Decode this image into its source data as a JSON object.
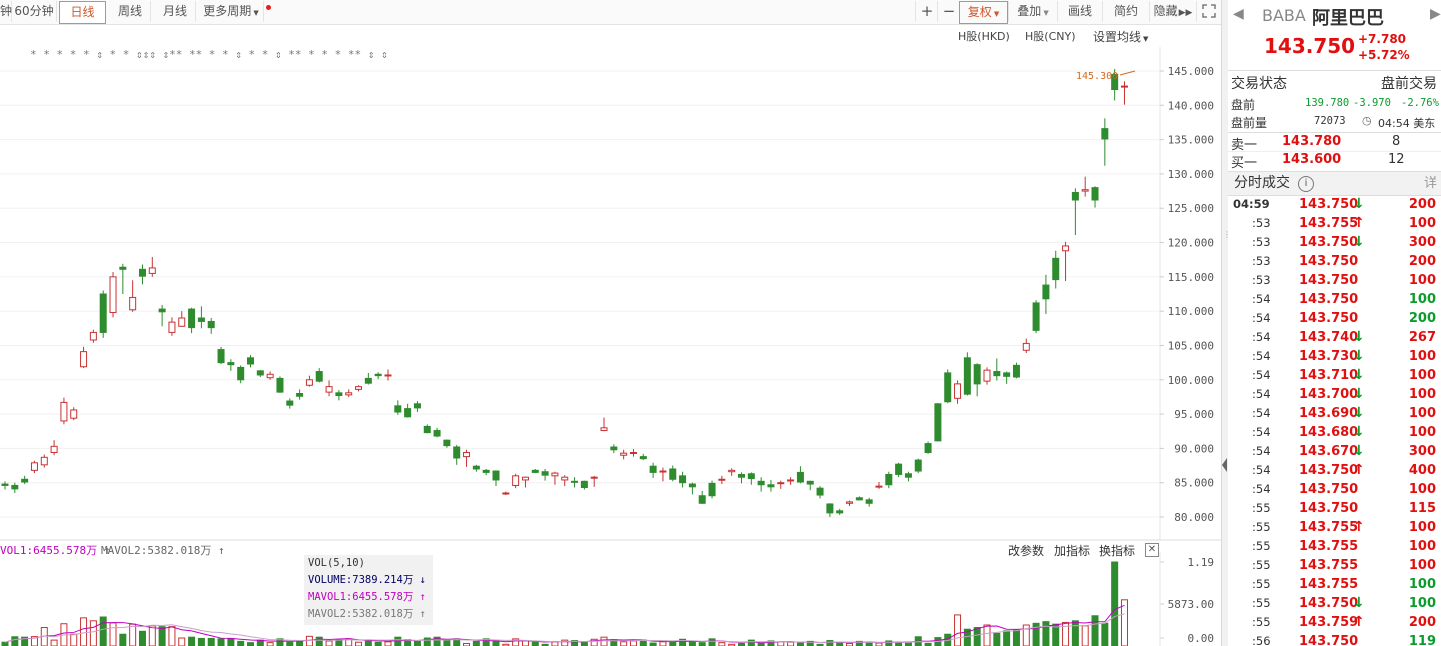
{
  "toolbar": {
    "periods": [
      {
        "label": "钟",
        "active": false
      },
      {
        "label": "60分钟",
        "active": false
      },
      {
        "label": "日线",
        "active": true
      },
      {
        "label": "周线",
        "active": false
      },
      {
        "label": "月线",
        "active": false
      },
      {
        "label": "更多周期",
        "active": false
      }
    ],
    "plus": "+",
    "minus": "−",
    "fuquan": "复权",
    "diejia": "叠加",
    "huaxian": "画线",
    "jianyue": "简约",
    "yincang": "隐藏",
    "expand_icon": "expand-icon"
  },
  "overlay": {
    "hk_hkd": "H股(HKD)",
    "hk_cny": "H股(CNY)",
    "ma_setting": "设置均线",
    "max_label": "145.300",
    "markers": "* * * * * ⇕ * * ⇕⇕⇕ ⇕** ** * * ⇕ * * ⇕ ** * * * ** ⇕ ⇕"
  },
  "price_axis": [
    "145.000",
    "140.000",
    "135.000",
    "130.000",
    "125.000",
    "120.000",
    "115.000",
    "110.000",
    "105.000",
    "100.000",
    "95.000",
    "90.000",
    "85.000",
    "80.000"
  ],
  "vol_axis": [
    "1.19",
    "5873.00",
    "0.00"
  ],
  "vol_header": {
    "mavol1": "VOL1:6455.578万",
    "mavol2": "MAVOL2:5382.018万",
    "gaicanshu": "改参数",
    "jiazhibiao": "加指标",
    "huanzhibiao": "换指标"
  },
  "tooltip": {
    "title": "VOL(5,10)",
    "volume": "VOLUME:7389.214万",
    "mavol1": "MAVOL1:6455.578万",
    "mavol2": "MAVOL2:5382.018万"
  },
  "quote": {
    "symbol": "BABA",
    "name": "阿里巴巴",
    "price": "143.750",
    "change": "+7.780",
    "change_pct": "+5.72%",
    "status_label": "交易状态",
    "status_value": "盘前交易",
    "pre_label": "盘前",
    "pre_price": "139.780",
    "pre_change": "-3.970",
    "pre_pct": "-2.76%",
    "pre_vol_label": "盘前量",
    "pre_vol": "72073",
    "time": "04:54 美东",
    "sell_label": "卖一",
    "sell_price": "143.780",
    "sell_qty": "8",
    "buy_label": "买一",
    "buy_price": "143.600",
    "buy_qty": "12"
  },
  "ticks_section": {
    "title": "分时成交",
    "detail": "详"
  },
  "ticks": [
    {
      "time": "04:59",
      "price": "143.750",
      "dir": "down",
      "vol": "200",
      "vc": "red"
    },
    {
      "time": ":53",
      "price": "143.755",
      "dir": "up",
      "vol": "100",
      "vc": "red"
    },
    {
      "time": ":53",
      "price": "143.750",
      "dir": "down",
      "vol": "300",
      "vc": "red"
    },
    {
      "time": ":53",
      "price": "143.750",
      "dir": "",
      "vol": "200",
      "vc": "red"
    },
    {
      "time": ":53",
      "price": "143.750",
      "dir": "",
      "vol": "100",
      "vc": "red"
    },
    {
      "time": ":54",
      "price": "143.750",
      "dir": "",
      "vol": "100",
      "vc": "green"
    },
    {
      "time": ":54",
      "price": "143.750",
      "dir": "",
      "vol": "200",
      "vc": "green"
    },
    {
      "time": ":54",
      "price": "143.740",
      "dir": "down",
      "vol": "267",
      "vc": "red"
    },
    {
      "time": ":54",
      "price": "143.730",
      "dir": "down",
      "vol": "100",
      "vc": "red"
    },
    {
      "time": ":54",
      "price": "143.710",
      "dir": "down",
      "vol": "100",
      "vc": "red"
    },
    {
      "time": ":54",
      "price": "143.700",
      "dir": "down",
      "vol": "100",
      "vc": "red"
    },
    {
      "time": ":54",
      "price": "143.690",
      "dir": "down",
      "vol": "100",
      "vc": "red"
    },
    {
      "time": ":54",
      "price": "143.680",
      "dir": "down",
      "vol": "100",
      "vc": "red"
    },
    {
      "time": ":54",
      "price": "143.670",
      "dir": "down",
      "vol": "300",
      "vc": "red"
    },
    {
      "time": ":54",
      "price": "143.750",
      "dir": "up",
      "vol": "400",
      "vc": "red"
    },
    {
      "time": ":54",
      "price": "143.750",
      "dir": "",
      "vol": "100",
      "vc": "red"
    },
    {
      "time": ":55",
      "price": "143.750",
      "dir": "",
      "vol": "115",
      "vc": "red"
    },
    {
      "time": ":55",
      "price": "143.755",
      "dir": "up",
      "vol": "100",
      "vc": "red"
    },
    {
      "time": ":55",
      "price": "143.755",
      "dir": "",
      "vol": "100",
      "vc": "red"
    },
    {
      "time": ":55",
      "price": "143.755",
      "dir": "",
      "vol": "100",
      "vc": "red"
    },
    {
      "time": ":55",
      "price": "143.755",
      "dir": "",
      "vol": "100",
      "vc": "green"
    },
    {
      "time": ":55",
      "price": "143.750",
      "dir": "down",
      "vol": "100",
      "vc": "green"
    },
    {
      "time": ":55",
      "price": "143.759",
      "dir": "up",
      "vol": "200",
      "vc": "red"
    },
    {
      "time": ":56",
      "price": "143.750",
      "dir": "",
      "vol": "119",
      "vc": "green"
    }
  ],
  "chart_data": {
    "type": "candlestick",
    "price_range": [
      78,
      146
    ],
    "candles": [
      [
        84.8,
        84.6,
        85.2,
        84.0
      ],
      [
        84.6,
        84.1,
        85.0,
        83.5
      ],
      [
        85.5,
        85.1,
        86.0,
        84.8
      ],
      [
        86.8,
        87.9,
        88.2,
        86.4
      ],
      [
        87.6,
        88.7,
        89.1,
        87.2
      ],
      [
        89.4,
        90.3,
        91.2,
        89.0
      ],
      [
        94.0,
        96.7,
        97.4,
        93.5
      ],
      [
        94.4,
        95.6,
        96.0,
        94.1
      ],
      [
        101.9,
        104.1,
        104.8,
        101.7
      ],
      [
        105.8,
        106.9,
        107.3,
        105.4
      ],
      [
        112.5,
        106.9,
        113.0,
        106.1
      ],
      [
        109.8,
        115.0,
        115.7,
        109.1
      ],
      [
        116.4,
        116.1,
        116.9,
        112.5
      ],
      [
        110.2,
        112.0,
        114.5,
        109.9
      ],
      [
        116.1,
        115.1,
        116.8,
        113.9
      ],
      [
        115.5,
        116.3,
        117.9,
        115.0
      ],
      [
        110.3,
        109.9,
        110.9,
        107.8
      ],
      [
        106.9,
        108.4,
        109.1,
        106.4
      ],
      [
        107.8,
        109.0,
        110.0,
        107.7
      ],
      [
        110.3,
        107.6,
        110.5,
        106.8
      ],
      [
        109.0,
        108.5,
        110.7,
        107.5
      ],
      [
        108.5,
        107.6,
        109.0,
        106.7
      ],
      [
        104.4,
        102.5,
        104.8,
        102.3
      ],
      [
        102.5,
        102.2,
        103.0,
        101.3
      ],
      [
        101.8,
        100.0,
        102.1,
        99.5
      ],
      [
        103.2,
        102.3,
        103.6,
        101.8
      ],
      [
        101.3,
        100.7,
        101.4,
        100.4
      ],
      [
        100.3,
        100.8,
        101.2,
        100.0
      ],
      [
        100.2,
        98.2,
        100.5,
        98.1
      ],
      [
        96.9,
        96.3,
        97.3,
        95.8
      ],
      [
        98.0,
        97.6,
        98.6,
        97.1
      ],
      [
        99.2,
        100.0,
        100.6,
        99.0
      ],
      [
        101.2,
        99.8,
        101.7,
        99.6
      ],
      [
        98.2,
        99.0,
        99.9,
        97.6
      ],
      [
        98.1,
        97.7,
        98.5,
        97.0
      ],
      [
        97.8,
        98.1,
        98.6,
        97.5
      ],
      [
        98.6,
        99.0,
        99.2,
        98.3
      ],
      [
        100.2,
        99.5,
        101.0,
        99.3
      ],
      [
        100.8,
        100.6,
        101.1,
        100.1
      ],
      [
        100.6,
        100.7,
        101.5,
        99.9
      ],
      [
        96.2,
        95.3,
        97.0,
        94.9
      ],
      [
        95.8,
        94.6,
        96.5,
        94.5
      ],
      [
        96.5,
        95.9,
        96.9,
        95.3
      ],
      [
        93.2,
        92.3,
        93.5,
        92.2
      ],
      [
        92.6,
        91.8,
        93.0,
        91.6
      ],
      [
        91.2,
        90.4,
        91.3,
        90.1
      ],
      [
        90.2,
        88.6,
        90.5,
        87.6
      ],
      [
        88.8,
        89.4,
        89.8,
        87.3
      ],
      [
        87.4,
        87.0,
        87.6,
        86.6
      ],
      [
        86.8,
        86.5,
        87.0,
        86.1
      ],
      [
        86.7,
        85.4,
        86.8,
        84.5
      ],
      [
        83.5,
        83.5,
        83.7,
        83.2
      ],
      [
        84.6,
        86.0,
        86.3,
        84.2
      ],
      [
        85.4,
        85.8,
        85.9,
        84.3
      ],
      [
        86.8,
        86.5,
        87.0,
        86.4
      ],
      [
        86.6,
        86.1,
        87.0,
        85.3
      ],
      [
        86.0,
        86.4,
        86.6,
        84.7
      ],
      [
        85.4,
        85.8,
        86.1,
        84.5
      ],
      [
        85.2,
        85.1,
        85.8,
        84.3
      ],
      [
        85.2,
        84.3,
        85.3,
        84.0
      ],
      [
        85.7,
        85.8,
        86.0,
        84.4
      ],
      [
        92.6,
        93.0,
        94.5,
        92.5
      ],
      [
        90.2,
        89.8,
        90.6,
        89.3
      ],
      [
        89.0,
        89.3,
        89.8,
        88.4
      ],
      [
        89.4,
        89.4,
        89.9,
        88.8
      ],
      [
        88.8,
        88.5,
        89.2,
        88.3
      ],
      [
        87.4,
        86.5,
        87.9,
        85.7
      ],
      [
        86.6,
        86.7,
        87.2,
        85.2
      ],
      [
        87.0,
        85.5,
        87.5,
        85.2
      ],
      [
        86.0,
        85.0,
        86.6,
        84.3
      ],
      [
        84.8,
        84.4,
        85.0,
        83.3
      ],
      [
        83.1,
        82.0,
        83.8,
        81.9
      ],
      [
        84.9,
        83.1,
        85.3,
        82.7
      ],
      [
        85.5,
        85.5,
        86.0,
        84.8
      ],
      [
        86.6,
        86.8,
        87.1,
        86.0
      ],
      [
        86.2,
        85.8,
        86.5,
        84.9
      ],
      [
        86.3,
        85.6,
        86.5,
        84.7
      ],
      [
        85.2,
        84.7,
        85.8,
        83.7
      ],
      [
        84.7,
        84.4,
        85.4,
        83.7
      ],
      [
        85.0,
        85.0,
        85.3,
        84.1
      ],
      [
        85.4,
        85.4,
        85.8,
        84.7
      ],
      [
        86.5,
        85.1,
        87.4,
        84.9
      ],
      [
        85.2,
        84.8,
        85.3,
        83.9
      ],
      [
        84.2,
        83.2,
        84.5,
        82.7
      ],
      [
        81.9,
        80.6,
        82.0,
        80.0
      ],
      [
        80.9,
        80.6,
        81.2,
        80.3
      ],
      [
        82.0,
        82.2,
        82.4,
        81.6
      ],
      [
        82.8,
        82.5,
        83.0,
        82.4
      ],
      [
        82.5,
        82.0,
        82.8,
        81.5
      ],
      [
        84.5,
        84.5,
        85.1,
        84.1
      ],
      [
        86.2,
        84.7,
        86.6,
        84.2
      ],
      [
        87.7,
        86.2,
        87.9,
        85.8
      ],
      [
        86.3,
        85.8,
        86.6,
        85.2
      ],
      [
        88.3,
        86.7,
        88.5,
        86.4
      ],
      [
        90.7,
        89.4,
        91.0,
        89.2
      ],
      [
        96.5,
        91.1,
        96.6,
        91.0
      ],
      [
        101.0,
        96.8,
        101.5,
        96.6
      ],
      [
        97.3,
        99.4,
        99.9,
        96.5
      ],
      [
        103.2,
        97.9,
        104.0,
        97.7
      ],
      [
        102.2,
        99.4,
        102.4,
        97.6
      ],
      [
        99.8,
        101.4,
        101.8,
        99.3
      ],
      [
        101.2,
        100.6,
        103.1,
        99.9
      ],
      [
        101.0,
        100.5,
        101.2,
        99.4
      ],
      [
        102.1,
        100.4,
        102.5,
        100.2
      ],
      [
        104.3,
        105.3,
        106.0,
        103.9
      ],
      [
        111.2,
        107.2,
        111.6,
        106.8
      ],
      [
        113.8,
        111.8,
        115.3,
        109.6
      ],
      [
        117.7,
        114.6,
        118.8,
        113.3
      ],
      [
        118.8,
        119.5,
        120.1,
        114.4
      ],
      [
        127.3,
        126.2,
        127.9,
        121.1
      ],
      [
        127.5,
        127.7,
        129.6,
        126.7
      ],
      [
        128.0,
        126.2,
        128.2,
        125.1
      ],
      [
        136.6,
        135.1,
        138.1,
        131.2
      ],
      [
        144.5,
        142.3,
        145.3,
        140.7
      ],
      [
        142.7,
        142.8,
        143.5,
        140.1
      ]
    ],
    "volumes": [
      0.045,
      0.11,
      0.105,
      0.112,
      0.22,
      0.07,
      0.265,
      0.14,
      0.335,
      0.3,
      0.345,
      0.275,
      0.14,
      0.26,
      0.175,
      0.24,
      0.23,
      0.23,
      0.095,
      0.105,
      0.09,
      0.09,
      0.085,
      0.085,
      0.055,
      0.04,
      0.07,
      0.04,
      0.085,
      0.045,
      0.06,
      0.115,
      0.105,
      0.06,
      0.075,
      0.085,
      0.045,
      0.065,
      0.045,
      0.05,
      0.105,
      0.075,
      0.055,
      0.095,
      0.105,
      0.075,
      0.085,
      0.03,
      0.055,
      0.085,
      0.06,
      0.02,
      0.085,
      0.065,
      0.045,
      0.02,
      0.05,
      0.07,
      0.065,
      0.045,
      0.08,
      0.105,
      0.075,
      0.05,
      0.06,
      0.07,
      0.035,
      0.05,
      0.045,
      0.08,
      0.055,
      0.04,
      0.085,
      0.04,
      0.02,
      0.03,
      0.07,
      0.035,
      0.06,
      0.05,
      0.045,
      0.035,
      0.055,
      0.02,
      0.065,
      0.045,
      0.03,
      0.055,
      0.04,
      0.035,
      0.06,
      0.04,
      0.045,
      0.11,
      0.03,
      0.1,
      0.14,
      0.37,
      0.2,
      0.22,
      0.25,
      0.15,
      0.18,
      0.19,
      0.25,
      0.27,
      0.29,
      0.26,
      0.28,
      0.3,
      0.24,
      0.36,
      0.27,
      1.0,
      0.55
    ],
    "vol_range": [
      0,
      1.19
    ]
  }
}
